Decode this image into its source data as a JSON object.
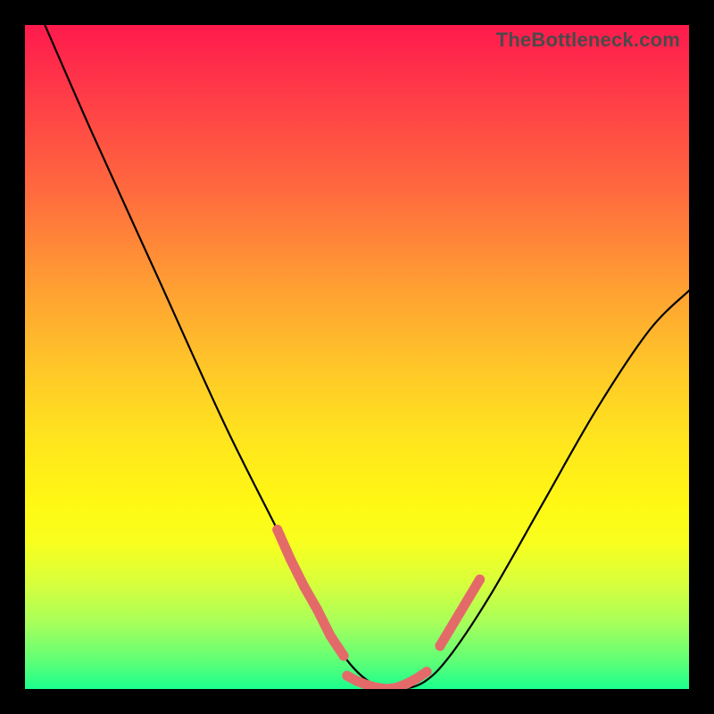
{
  "watermark": "TheBottleneck.com",
  "chart_data": {
    "type": "line",
    "title": "",
    "xlabel": "",
    "ylabel": "",
    "xlim": [
      0,
      100
    ],
    "ylim": [
      0,
      100
    ],
    "series": [
      {
        "name": "curve",
        "x": [
          3,
          10,
          20,
          30,
          38,
          44,
          48,
          52,
          56,
          60,
          64,
          70,
          78,
          86,
          94,
          100
        ],
        "y": [
          100,
          84,
          62,
          40,
          24,
          12,
          5,
          1,
          0,
          1,
          5,
          14,
          28,
          42,
          54,
          60
        ]
      }
    ],
    "highlight_segments": [
      {
        "name": "left-highlight",
        "x": [
          38.0,
          40.0,
          42.0,
          44.0,
          46.0,
          48.0
        ],
        "y": [
          24.0,
          19.5,
          15.5,
          12.0,
          8.0,
          5.0
        ]
      },
      {
        "name": "bottom-highlight",
        "x": [
          48.5,
          50.0,
          51.5,
          53.0,
          54.5,
          56.0,
          57.5,
          59.0,
          60.5
        ],
        "y": [
          2.0,
          1.2,
          0.6,
          0.2,
          0.0,
          0.2,
          0.8,
          1.6,
          2.6
        ]
      },
      {
        "name": "right-highlight",
        "x": [
          62.5,
          64.0,
          65.5,
          67.0,
          68.5
        ],
        "y": [
          6.5,
          9.0,
          11.5,
          14.0,
          16.5
        ]
      }
    ],
    "colors": {
      "curve": "#000000",
      "highlight": "#e46a6a"
    }
  }
}
